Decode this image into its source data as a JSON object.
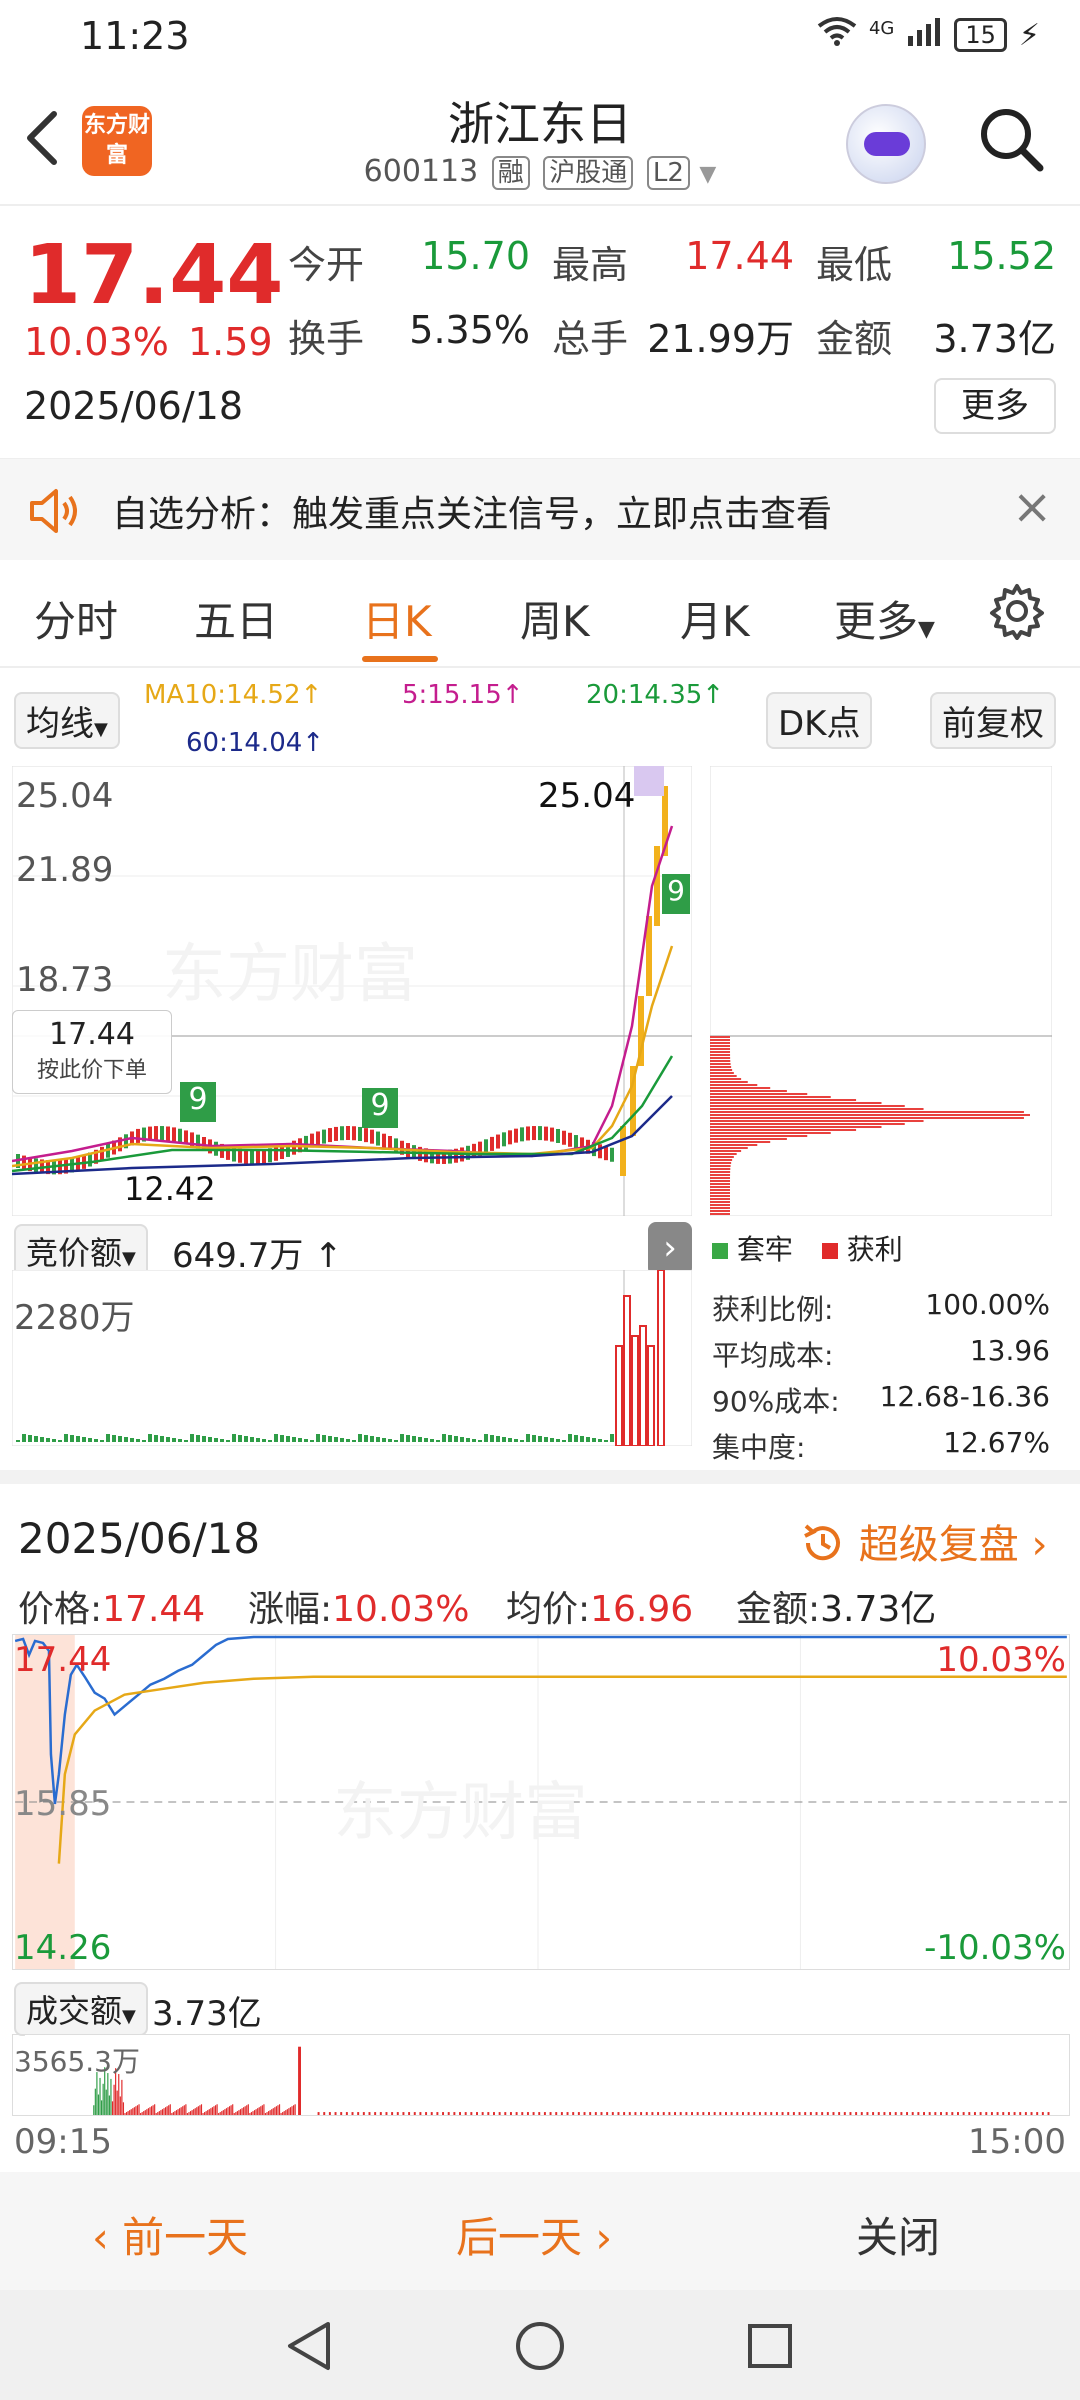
{
  "status_bar": {
    "time": "11:23",
    "network": "4G",
    "battery": "15"
  },
  "header": {
    "back_icon": "chevron-left-icon",
    "logo_text": "东方财富",
    "title": "浙江东日",
    "code": "600113",
    "tags": [
      "融",
      "沪股通",
      "L2"
    ]
  },
  "quote": {
    "price": "17.44",
    "change_pct": "10.03%",
    "change_amt": "1.59",
    "date": "2025/06/18",
    "fields": [
      {
        "label": "今开",
        "value": "15.70",
        "color": "#1a9a3a"
      },
      {
        "label": "最高",
        "value": "17.44",
        "color": "#e02b2b"
      },
      {
        "label": "最低",
        "value": "15.52",
        "color": "#1a9a3a"
      },
      {
        "label": "换手",
        "value": "5.35%",
        "color": "#222222"
      },
      {
        "label": "总手",
        "value": "21.99万",
        "color": "#222222"
      },
      {
        "label": "金额",
        "value": "3.73亿",
        "color": "#222222"
      }
    ],
    "more_label": "更多"
  },
  "banner": {
    "text": "自选分析：触发重点关注信号，立即点击查看"
  },
  "tabs": {
    "items": [
      "分时",
      "五日",
      "日K",
      "周K",
      "月K",
      "更多"
    ],
    "active": "日K"
  },
  "indicator_bar": {
    "ma_select": "均线",
    "ma10": "MA10:14.52↑",
    "ma5": "5:15.15↑",
    "ma20": "20:14.35↑",
    "ma60": "60:14.04↑",
    "dk_label": "DK点",
    "adjust_label": "前复权"
  },
  "kline": {
    "y_labels": [
      "25.04",
      "21.89",
      "18.73"
    ],
    "high_label": "25.04",
    "low_label": "12.42",
    "tip_value": "17.44",
    "tip_sub": "按此价下单",
    "signal_numbers": [
      "9",
      "9",
      "9"
    ]
  },
  "volume_panel": {
    "select_label": "竞价额",
    "value": "649.7万",
    "max_label": "2280万"
  },
  "chip": {
    "legend": [
      "套牢",
      "获利"
    ],
    "legend_colors": [
      "#3aa846",
      "#e02b2b"
    ],
    "stats": [
      {
        "label": "获利比例:",
        "value": "100.00%"
      },
      {
        "label": "平均成本:",
        "value": "13.96"
      },
      {
        "label": "90%成本:",
        "value": "12.68-16.36"
      },
      {
        "label": "集中度:",
        "value": "12.67%"
      }
    ]
  },
  "detail": {
    "date": "2025/06/18",
    "replay_label": "超级复盘",
    "price_label": "价格:",
    "price": "17.44",
    "pct_label": "涨幅:",
    "pct": "10.03%",
    "avg_label": "均价:",
    "avg": "16.96",
    "amt_label": "金额:",
    "amt": "3.73亿",
    "y_high": "17.44",
    "y_mid": "15.85",
    "y_low": "14.26",
    "pct_high": "10.03%",
    "pct_low": "-10.03%",
    "vol_select": "成交额",
    "vol_value": "3.73亿",
    "vol_max": "3565.3万",
    "time_start": "09:15",
    "time_end": "15:00"
  },
  "bottom_bar": {
    "prev": "前一天",
    "next": "后一天",
    "close": "关闭"
  }
}
